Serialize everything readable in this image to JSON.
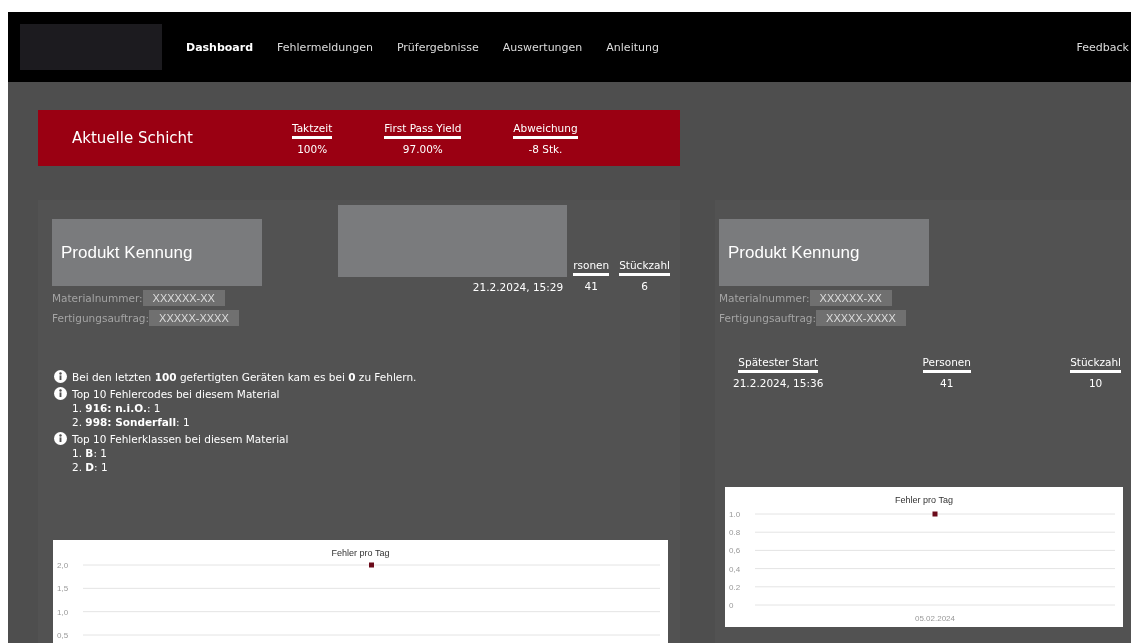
{
  "nav": {
    "items": [
      {
        "label": "Dashboard",
        "selected": true
      },
      {
        "label": "Fehlermeldungen",
        "selected": false
      },
      {
        "label": "Prüfergebnisse",
        "selected": false
      },
      {
        "label": "Auswertungen",
        "selected": false
      },
      {
        "label": "Anleitung",
        "selected": false
      }
    ],
    "feedback": "Feedback"
  },
  "shift_banner": {
    "title": "Aktuelle Schicht",
    "metrics": [
      {
        "label": "Taktzeit",
        "value": "100%"
      },
      {
        "label": "First Pass Yield",
        "value": "97.00%"
      },
      {
        "label": "Abweichung",
        "value": "-8 Stk."
      }
    ]
  },
  "cards": [
    {
      "kind": "redacted",
      "product": "Produkt Kennung",
      "fields": [
        {
          "label": "Materialnummer:",
          "value": "XXXXXX-XX"
        },
        {
          "label": "Fertigungsauftrag:",
          "value": "XXXXX-XXXX"
        }
      ],
      "stats": {
        "columns": [
          {
            "value": "21.2.2024, 15:29"
          },
          {
            "header": "rsonen",
            "value": "41"
          },
          {
            "header": "Stückzahl",
            "value": "6"
          }
        ]
      },
      "info": [
        {
          "text": "Bei den letzten **100** gefertigten Geräten kam es bei **0** zu Fehlern."
        },
        {
          "text": "Top 10 Fehlercodes bei diesem Material",
          "items": [
            "1. **916: n.i.O.**: 1",
            "2. **998: Sonderfall**: 1"
          ]
        },
        {
          "text": "Top 10 Fehlerklassen bei diesem Material",
          "items": [
            "1. **B**: 1",
            "2. **D**: 1"
          ]
        }
      ],
      "chart_data": {
        "type": "scatter",
        "title": "Fehler pro Tag",
        "categories": [
          null
        ],
        "grid": true,
        "ylim": [
          0.5,
          2
        ],
        "yticks": [
          {
            "value": 2,
            "label": "2,0"
          },
          {
            "value": 1.5,
            "label": "1,5"
          },
          {
            "value": 1,
            "label": "1,0"
          },
          {
            "value": 0.5,
            "label": "0,5"
          }
        ],
        "series": [
          {
            "color": "#6b0a1a",
            "values": [
              2
            ]
          }
        ]
      }
    },
    {
      "kind": "plain",
      "product": "Produkt Kennung",
      "fields": [
        {
          "label": "Materialnummer:",
          "value": "XXXXXX-XX"
        },
        {
          "label": "Fertigungsauftrag:",
          "value": "XXXXX-XXXX"
        }
      ],
      "stats": {
        "columns": [
          {
            "header": "Spätester Start",
            "value": "21.2.2024, 15:36"
          },
          {
            "header": "Personen",
            "value": "41"
          },
          {
            "header": "Stückzahl",
            "value": "10"
          }
        ]
      },
      "chart_data": {
        "type": "scatter",
        "title": "Fehler pro Tag",
        "categories": [
          "05.02.2024"
        ],
        "grid": true,
        "ylim": [
          0,
          1
        ],
        "yticks": [
          {
            "value": 1,
            "label": "1.0"
          },
          {
            "value": 0.8,
            "label": "0.8"
          },
          {
            "value": 0.6,
            "label": "0,6"
          },
          {
            "value": 0.4,
            "label": "0,4"
          },
          {
            "value": 0.2,
            "label": "0.2"
          },
          {
            "value": 0,
            "label": "0"
          }
        ],
        "series": [
          {
            "color": "#6b0a1a",
            "values": [
              1
            ]
          }
        ]
      }
    }
  ]
}
